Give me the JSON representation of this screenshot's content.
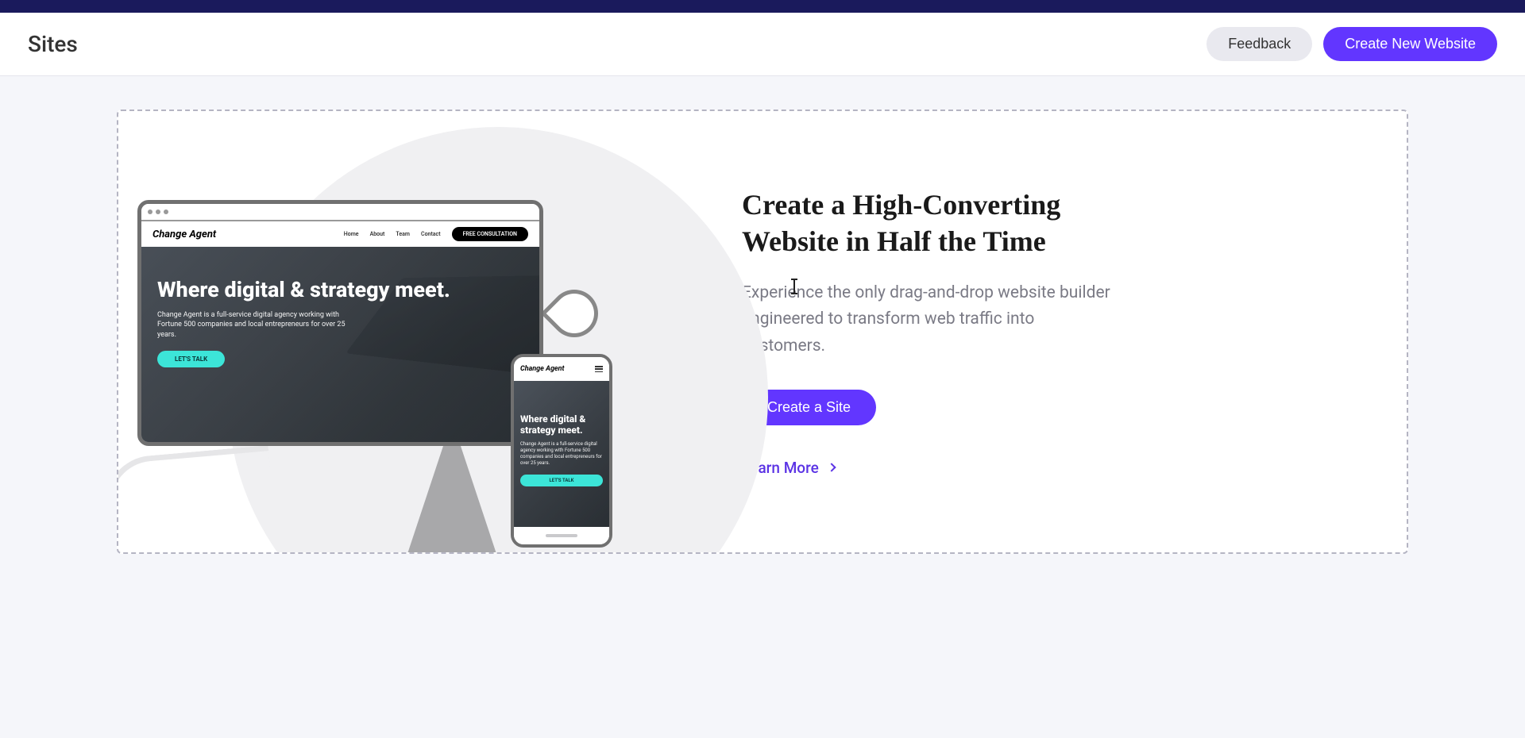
{
  "header": {
    "title": "Sites",
    "feedback_label": "Feedback",
    "create_new_label": "Create New Website"
  },
  "promo": {
    "headline": "Create a High-Converting Website in Half the Time",
    "description": "Experience the only drag-and-drop website builder engineered to transform web traffic into customers.",
    "primary_cta": "Create a Site",
    "learn_more": "Learn More"
  },
  "mockup": {
    "brand": "Change Agent",
    "nav": {
      "home": "Home",
      "about": "About",
      "team": "Team",
      "contact": "Contact",
      "cta": "FREE CONSULTATION"
    },
    "hero_headline": "Where digital & strategy meet.",
    "hero_copy": "Change Agent is a full-service digital agency working with Fortune 500 companies and local entrepreneurs for over 25 years.",
    "hero_cta": "LET'S TALK"
  },
  "colors": {
    "accent": "#6236ff",
    "teal": "#3ce5d8",
    "muted_bg": "#e9e9ef"
  }
}
